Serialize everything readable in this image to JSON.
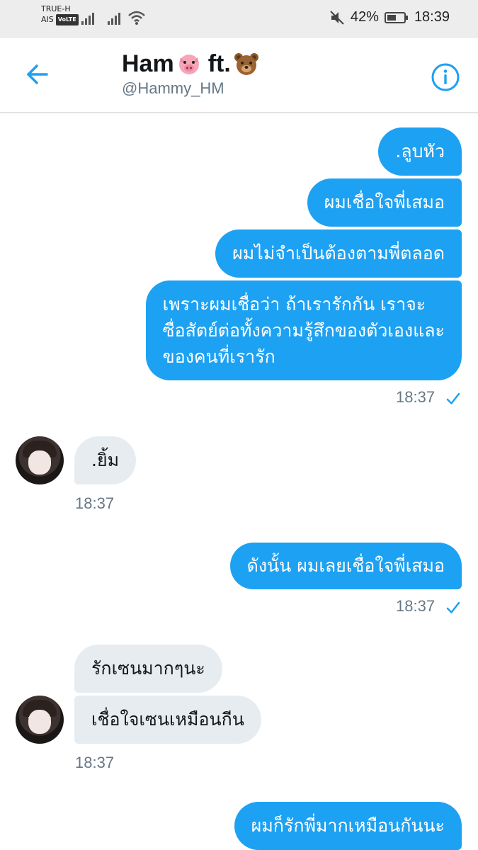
{
  "status_bar": {
    "carrier_top": "TRUE-H",
    "carrier_bottom": "AIS",
    "volte": "VoLTE",
    "battery": "42%",
    "time": "18:39"
  },
  "header": {
    "title_name": "Ham",
    "title_ft": "ft.",
    "handle": "@Hammy_HM"
  },
  "messages": [
    {
      "text": ".ลูบหัว"
    },
    {
      "text": "ผมเชื่อใจพี่เสมอ"
    },
    {
      "text": "ผมไม่จำเป็นต้องตามพี่ตลอด"
    },
    {
      "lines": [
        "เพราะผมเชื่อว่า ถ้าเรารักกัน เราจะ",
        "ซื่อสัตย์ต่อทั้งความรู้สึกของตัวเองและ",
        "ของคนที่เรารัก"
      ]
    },
    {
      "text": ".ยิ้ม"
    },
    {
      "text": "ดังนั้น ผมเลยเชื่อใจพี่เสมอ"
    },
    {
      "text": "รักเซนมากๆนะ"
    },
    {
      "text": "เชื่อใจเซนเหมือนกีน"
    },
    {
      "text": "ผมก็รักพี่มากเหมือนกันนะ"
    }
  ],
  "timestamps": [
    "18:37",
    "18:37",
    "18:37",
    "18:37"
  ],
  "colors": {
    "accent": "#1da1f2",
    "incoming_bubble": "#e6ecf0",
    "timestamp": "#657786"
  }
}
